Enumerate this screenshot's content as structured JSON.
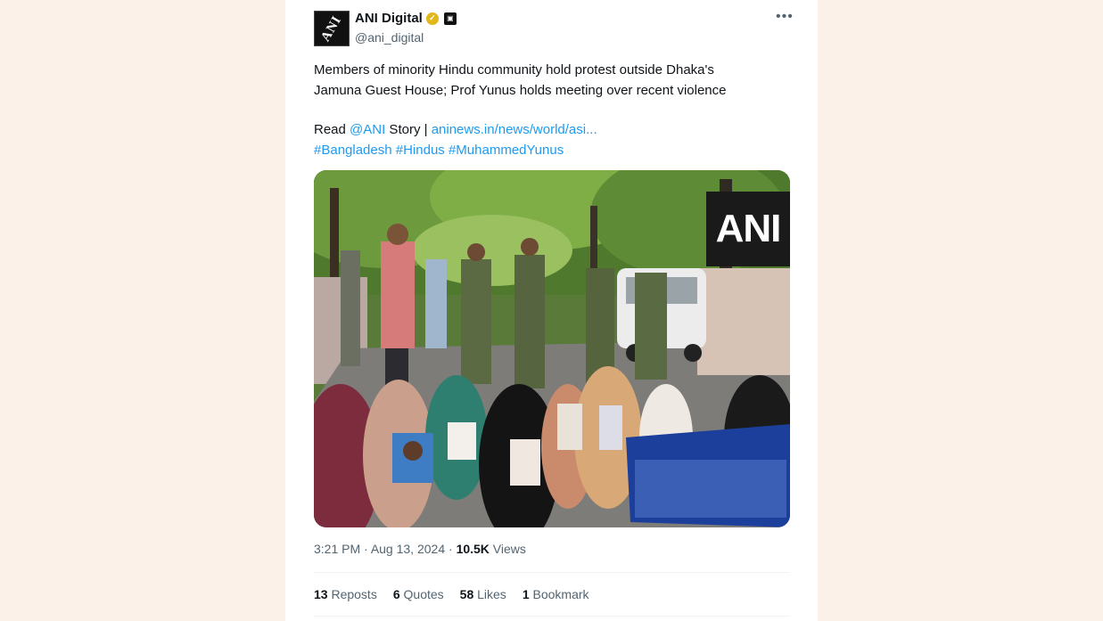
{
  "author": {
    "display_name": "ANI Digital",
    "handle": "@ani_digital",
    "avatar_text": "ANI",
    "verified_icon": "verified-badge-icon",
    "affiliate_icon": "affiliate-badge-icon"
  },
  "more_label": "•••",
  "tweet": {
    "line1": "Members of minority Hindu community hold protest outside Dhaka's",
    "line2": "Jamuna Guest House; Prof Yunus holds meeting over recent violence",
    "read_prefix": "Read ",
    "mention": "@ANI",
    "story_label": " Story | ",
    "url": "aninews.in/news/world/asi...",
    "hashtags": [
      "#Bangladesh",
      "#Hindus",
      "#MuhammedYunus"
    ]
  },
  "media": {
    "watermark": "ANI",
    "description_icon": "protest-photo"
  },
  "meta": {
    "time": "3:21 PM",
    "separator": " · ",
    "date": "Aug 13, 2024",
    "views_count": "10.5K",
    "views_label": " Views"
  },
  "stats": {
    "reposts_count": "13",
    "reposts_label": " Reposts",
    "quotes_count": "6",
    "quotes_label": " Quotes",
    "likes_count": "58",
    "likes_label": " Likes",
    "bookmarks_count": "1",
    "bookmarks_label": " Bookmark"
  },
  "colors": {
    "background": "#fbf1e8",
    "link": "#1d9bf0",
    "secondary_text": "#536471",
    "verified_gold": "#e2b719"
  }
}
